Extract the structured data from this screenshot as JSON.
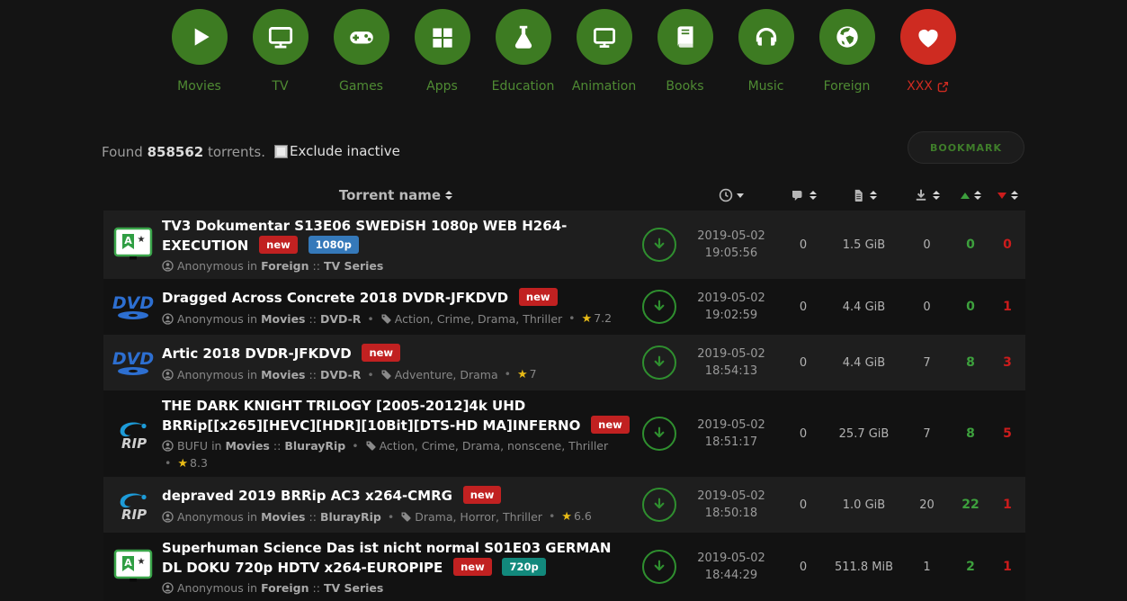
{
  "nav": {
    "items": [
      {
        "label": "Movies",
        "icon": "play-icon"
      },
      {
        "label": "TV",
        "icon": "tv-icon"
      },
      {
        "label": "Games",
        "icon": "gamepad-icon"
      },
      {
        "label": "Apps",
        "icon": "windows-icon"
      },
      {
        "label": "Education",
        "icon": "flask-icon"
      },
      {
        "label": "Animation",
        "icon": "monitor-icon"
      },
      {
        "label": "Books",
        "icon": "book-icon"
      },
      {
        "label": "Music",
        "icon": "headphones-icon"
      },
      {
        "label": "Foreign",
        "icon": "globe-icon"
      },
      {
        "label": "XXX",
        "icon": "heart-icon",
        "external": true
      }
    ],
    "circle_color": "#3d7b22",
    "xxx_color": "#ce2b21"
  },
  "toolbar": {
    "found_prefix": "Found",
    "found_count": "858562",
    "found_suffix": "torrents.",
    "exclude_label": "Exclude inactive",
    "bookmark_label": "BOOKMARK"
  },
  "table": {
    "header": {
      "name_label": "Torrent name"
    },
    "rows": [
      {
        "icon": "translate-tv",
        "title": "TV3 Dokumentar S13E06 SWEDiSH 1080p WEB H264-EXECUTION",
        "badge_new": "new",
        "badge_quality": "1080p",
        "quality_style": "background:#3579ba",
        "uploader": "Anonymous",
        "in_word": "in",
        "category": "Foreign",
        "sep": "::",
        "subcategory": "TV Series",
        "date": "2019-05-02",
        "time": "19:05:56",
        "comments": "0",
        "size": "1.5 GiB",
        "completed": "0",
        "seeders": "0",
        "leechers": "0"
      },
      {
        "icon": "dvd",
        "title": "Dragged Across Concrete 2018 DVDR-JFKDVD",
        "badge_new": "new",
        "uploader": "Anonymous",
        "in_word": "in",
        "category": "Movies",
        "sep": "::",
        "subcategory": "DVD-R",
        "tags": "Action, Crime, Drama, Thriller",
        "rating": "7.2",
        "date": "2019-05-02",
        "time": "19:02:59",
        "comments": "0",
        "size": "4.4 GiB",
        "completed": "0",
        "seeders": "0",
        "leechers": "1"
      },
      {
        "icon": "dvd",
        "title": "Artic 2018 DVDR-JFKDVD",
        "badge_new": "new",
        "uploader": "Anonymous",
        "in_word": "in",
        "category": "Movies",
        "sep": "::",
        "subcategory": "DVD-R",
        "tags": "Adventure, Drama",
        "rating": "7",
        "date": "2019-05-02",
        "time": "18:54:13",
        "comments": "0",
        "size": "4.4 GiB",
        "completed": "7",
        "seeders": "8",
        "leechers": "3"
      },
      {
        "icon": "bluray",
        "title": "THE DARK KNIGHT TRILOGY [2005-2012]4k UHD BRRip[[x265][HEVC][HDR][10Bit][DTS-HD MA]INFERNO",
        "badge_new": "new",
        "uploader": "BUFU",
        "in_word": "in",
        "category": "Movies",
        "sep": "::",
        "subcategory": "BlurayRip",
        "tags": "Action, Crime, Drama, nonscene, Thriller",
        "rating": "8.3",
        "date": "2019-05-02",
        "time": "18:51:17",
        "comments": "0",
        "size": "25.7 GiB",
        "completed": "7",
        "seeders": "8",
        "leechers": "5"
      },
      {
        "icon": "bluray",
        "title": "depraved 2019 BRRip AC3 x264-CMRG",
        "badge_new": "new",
        "uploader": "Anonymous",
        "in_word": "in",
        "category": "Movies",
        "sep": "::",
        "subcategory": "BlurayRip",
        "tags": "Drama, Horror, Thriller",
        "rating": "6.6",
        "date": "2019-05-02",
        "time": "18:50:18",
        "comments": "0",
        "size": "1.0 GiB",
        "completed": "20",
        "seeders": "22",
        "leechers": "1"
      },
      {
        "icon": "translate-tv",
        "title": "Superhuman Science Das ist nicht normal S01E03 GERMAN DL DOKU 720p HDTV x264-EUROPIPE",
        "badge_new": "new",
        "badge_quality": "720p",
        "quality_style": "background:#12897c",
        "uploader": "Anonymous",
        "in_word": "in",
        "category": "Foreign",
        "sep": "::",
        "subcategory": "TV Series",
        "date": "2019-05-02",
        "time": "18:44:29",
        "comments": "0",
        "size": "511.8 MiB",
        "completed": "1",
        "seeders": "2",
        "leechers": "1"
      }
    ]
  },
  "colors": {
    "accent_green": "#3d7b22",
    "nav_label_green": "#4f8b33",
    "xxx_red": "#ce2b21",
    "new_badge": "#c12121",
    "badge_1080p": "#3579ba",
    "badge_720p": "#12897c",
    "seeders_green": "#3da03d",
    "leechers_red": "#cc1c1c",
    "row_odd": "#1e1e1e",
    "row_even": "#121212"
  }
}
